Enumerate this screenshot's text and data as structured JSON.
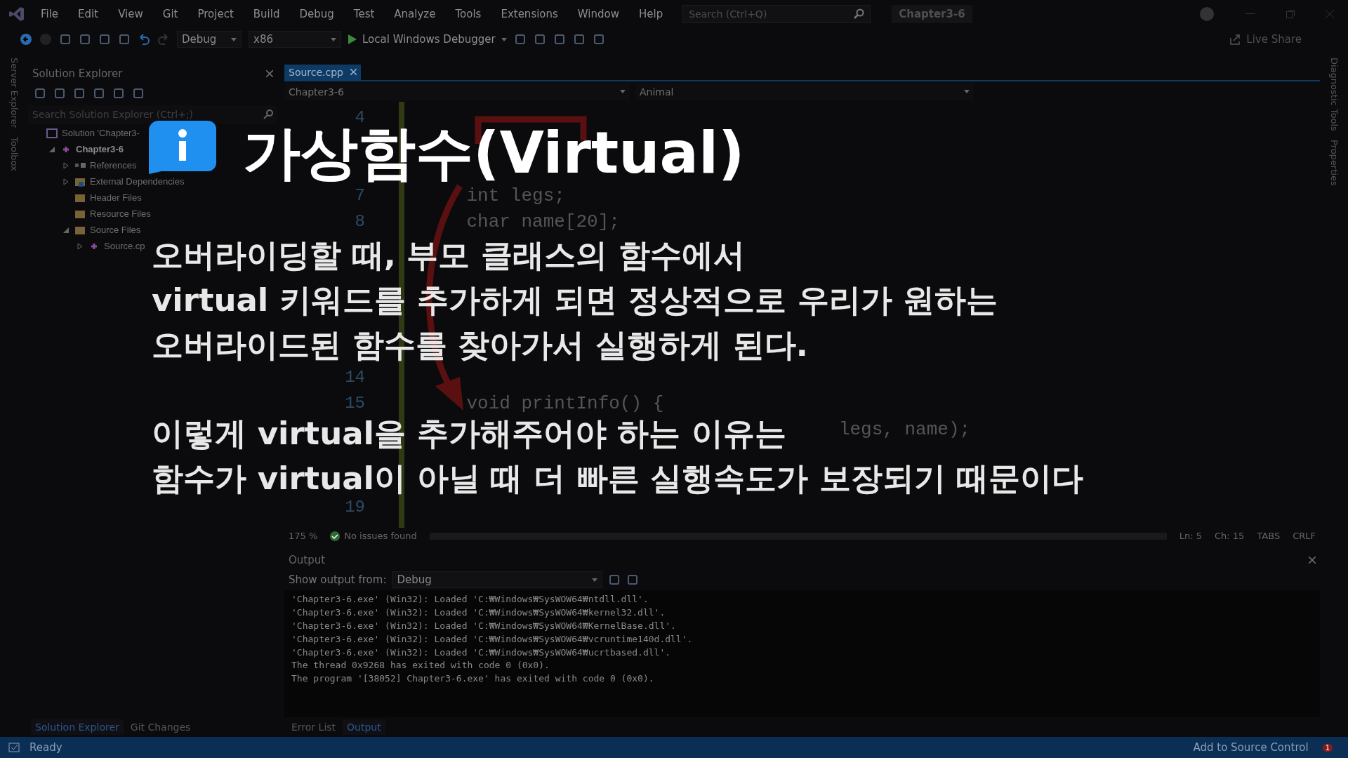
{
  "title_bar": {
    "menus": [
      "File",
      "Edit",
      "View",
      "Git",
      "Project",
      "Build",
      "Debug",
      "Test",
      "Analyze",
      "Tools",
      "Extensions",
      "Window",
      "Help"
    ],
    "search": {
      "placeholder": "Search (Ctrl+Q)"
    },
    "solution_name": "Chapter3-6"
  },
  "toolbar": {
    "configuration": "Debug",
    "platform": "x86",
    "run_target": "Local Windows Debugger",
    "live_share": "Live Share"
  },
  "left_strip": [
    "Server Explorer",
    "Toolbox"
  ],
  "right_strip": [
    "Diagnostic Tools",
    "Properties"
  ],
  "solution_explorer": {
    "title": "Solution Explorer",
    "search": {
      "placeholder": "Search Solution Explorer (Ctrl+;)"
    },
    "tree": [
      {
        "label": "Solution 'Chapter3-",
        "kind": "solution",
        "children": [
          {
            "label": "Chapter3-6",
            "kind": "project",
            "expanded": true,
            "children": [
              {
                "label": "References",
                "kind": "references",
                "expanded": false
              },
              {
                "label": "External Dependencies",
                "kind": "dependencies",
                "expanded": false
              },
              {
                "label": "Header Files",
                "kind": "folder"
              },
              {
                "label": "Resource Files",
                "kind": "folder"
              },
              {
                "label": "Source Files",
                "kind": "folder",
                "expanded": true,
                "children": [
                  {
                    "label": "Source.cp",
                    "kind": "cpp",
                    "expanded": false
                  }
                ]
              }
            ]
          }
        ]
      }
    ],
    "tabs": [
      {
        "label": "Solution Explorer",
        "selected": true
      },
      {
        "label": "Git Changes",
        "selected": false
      }
    ]
  },
  "editor": {
    "tabs": [
      {
        "label": "Source.cpp",
        "selected": true
      }
    ],
    "scope": "Chapter3-6",
    "member": "Animal",
    "lines": [
      {
        "kind": "line",
        "number": "4"
      },
      {
        "kind": "covered"
      },
      {
        "kind": "covered"
      },
      {
        "kind": "line",
        "number": "7",
        "code": "    int legs;"
      },
      {
        "kind": "line",
        "number": "8",
        "code": "    char name[20];"
      },
      {
        "kind": "covered"
      },
      {
        "kind": "covered"
      },
      {
        "kind": "covered"
      },
      {
        "kind": "covered"
      },
      {
        "kind": "covered"
      },
      {
        "kind": "line",
        "number": "14"
      },
      {
        "kind": "line",
        "number": "15",
        "code": "    void printInfo() {"
      },
      {
        "kind": "line",
        "code": "                                      legs, name);"
      },
      {
        "kind": "covered"
      },
      {
        "kind": "covered"
      },
      {
        "kind": "line",
        "number": "19"
      }
    ],
    "zoom": "175 %",
    "issues": "No issues found",
    "position": [
      "Ln: 5",
      "Ch: 15",
      "TABS",
      "CRLF"
    ]
  },
  "output": {
    "title": "Output",
    "source_label": "Show output from:",
    "source": "Debug",
    "lines": [
      "'Chapter3-6.exe' (Win32): Loaded 'C:₩Windows₩SysWOW64₩ntdll.dll'.",
      "'Chapter3-6.exe' (Win32): Loaded 'C:₩Windows₩SysWOW64₩kernel32.dll'.",
      "'Chapter3-6.exe' (Win32): Loaded 'C:₩Windows₩SysWOW64₩KernelBase.dll'.",
      "'Chapter3-6.exe' (Win32): Loaded 'C:₩Windows₩SysWOW64₩vcruntime140d.dll'.",
      "'Chapter3-6.exe' (Win32): Loaded 'C:₩Windows₩SysWOW64₩ucrtbased.dll'.",
      "The thread 0x9268 has exited with code 0 (0x0).",
      "The program '[38052] Chapter3-6.exe' has exited with code 0 (0x0)."
    ],
    "tabs": [
      {
        "label": "Error List",
        "selected": false
      },
      {
        "label": "Output",
        "selected": true
      }
    ]
  },
  "status_bar": {
    "state": "Ready",
    "source_control": "Add to Source Control",
    "notifications": "1"
  },
  "lecture_overlay": {
    "title": "가상함수(Virtual)",
    "paragraphs": [
      [
        "오버라이딩할 때, 부모 클래스의 함수에서",
        "virtual 키워드를 추가하게 되면 정상적으로 우리가 원하는",
        "오버라이드된 함수를 찾아가서 실행하게 된다."
      ],
      [
        "이렇게 virtual을 추가해주어야 하는 이유는",
        "함수가 virtual이 아닐 때 더 빠른 실행속도가 보장되기 때문이다"
      ]
    ]
  }
}
